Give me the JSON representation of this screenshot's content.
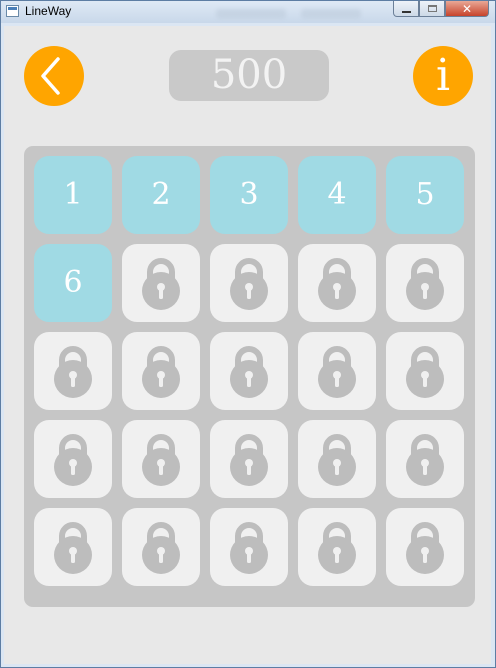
{
  "window": {
    "title": "LineWay"
  },
  "header": {
    "score": "500"
  },
  "level_grid": {
    "columns": 5,
    "levels": [
      {
        "label": "1",
        "locked": false
      },
      {
        "label": "2",
        "locked": false
      },
      {
        "label": "3",
        "locked": false
      },
      {
        "label": "4",
        "locked": false
      },
      {
        "label": "5",
        "locked": false
      },
      {
        "label": "6",
        "locked": false
      },
      {
        "label": "",
        "locked": true
      },
      {
        "label": "",
        "locked": true
      },
      {
        "label": "",
        "locked": true
      },
      {
        "label": "",
        "locked": true
      },
      {
        "label": "",
        "locked": true
      },
      {
        "label": "",
        "locked": true
      },
      {
        "label": "",
        "locked": true
      },
      {
        "label": "",
        "locked": true
      },
      {
        "label": "",
        "locked": true
      },
      {
        "label": "",
        "locked": true
      },
      {
        "label": "",
        "locked": true
      },
      {
        "label": "",
        "locked": true
      },
      {
        "label": "",
        "locked": true
      },
      {
        "label": "",
        "locked": true
      },
      {
        "label": "",
        "locked": true
      },
      {
        "label": "",
        "locked": true
      },
      {
        "label": "",
        "locked": true
      },
      {
        "label": "",
        "locked": true
      },
      {
        "label": "",
        "locked": true
      }
    ]
  },
  "icons": {
    "back": "chevron-left-icon",
    "info": "info-icon",
    "locked_level": "padlock-icon"
  },
  "colors": {
    "accent": "#ffa500",
    "open_tile": "#a0dae4",
    "locked_tile": "#f0f0f0",
    "board": "#c6c6c6",
    "score_box": "#c9c9c9",
    "background": "#e8e8e8"
  }
}
